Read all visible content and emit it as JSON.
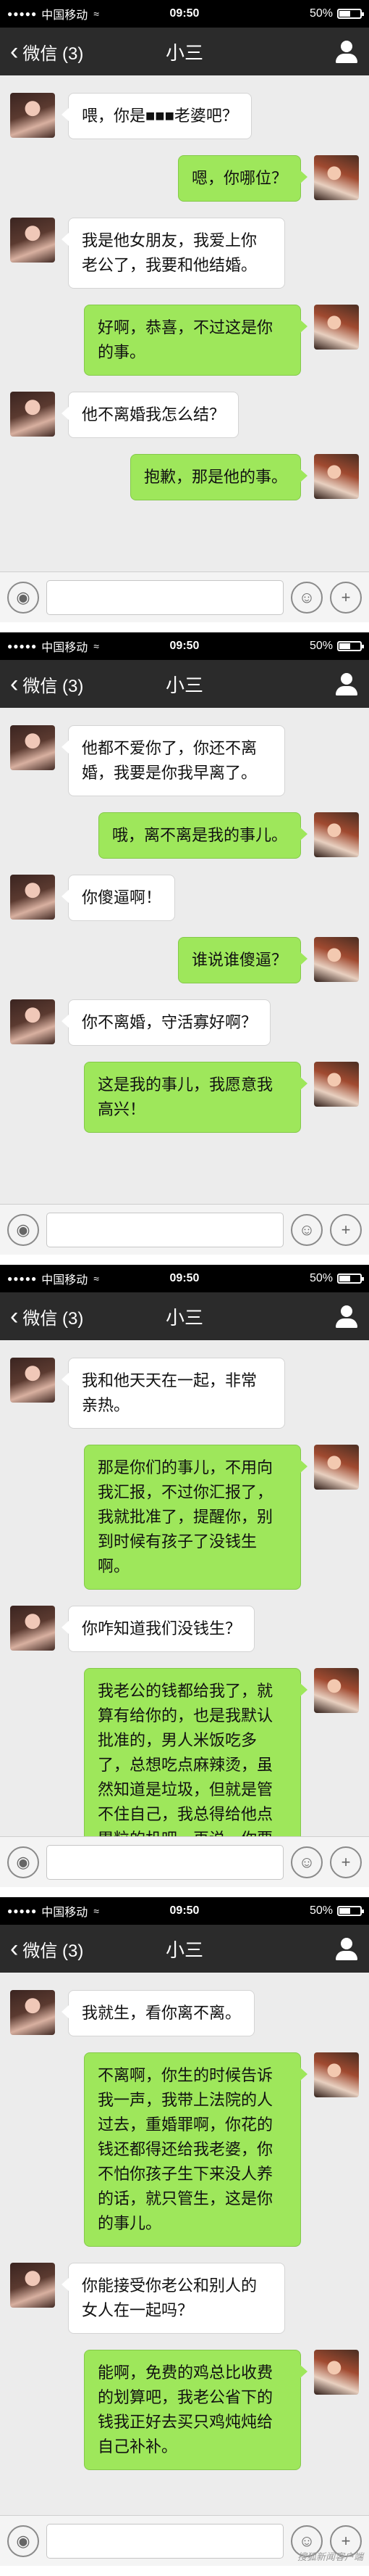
{
  "status_bar": {
    "signal": "●●●●●",
    "carrier": "中国移动",
    "wifi": "≈",
    "time": "09:50",
    "battery_pct": "50%"
  },
  "nav": {
    "back_label": "微信 (3)",
    "title": "小三"
  },
  "panels": [
    {
      "messages": [
        {
          "side": "left",
          "text": "喂，你是■■■老婆吧？"
        },
        {
          "side": "right",
          "text": "嗯，你哪位？"
        },
        {
          "side": "left",
          "text": "我是他女朋友，我爱上你老公了，我要和他结婚。"
        },
        {
          "side": "right",
          "text": "好啊，恭喜，不过这是你的事。"
        },
        {
          "side": "left",
          "text": "他不离婚我怎么结？"
        },
        {
          "side": "right",
          "text": "抱歉，那是他的事。"
        }
      ]
    },
    {
      "messages": [
        {
          "side": "left",
          "text": "他都不爱你了，你还不离婚，我要是你我早离了。"
        },
        {
          "side": "right",
          "text": "哦，离不离是我的事儿。"
        },
        {
          "side": "left",
          "text": "你傻逼啊！"
        },
        {
          "side": "right",
          "text": "谁说谁傻逼？"
        },
        {
          "side": "left",
          "text": "你不离婚，守活寡好啊？"
        },
        {
          "side": "right",
          "text": "这是我的事儿，我愿意我高兴！"
        }
      ]
    },
    {
      "messages": [
        {
          "side": "left",
          "text": "我和他天天在一起，非常亲热。"
        },
        {
          "side": "right",
          "text": "那是你们的事儿，不用向我汇报，不过你汇报了，我就批准了，提醒你，别到时候有孩子了没钱生啊。"
        },
        {
          "side": "left",
          "text": "你咋知道我们没钱生？"
        },
        {
          "side": "right",
          "text": "我老公的钱都给我了，就算有给你的，也是我默认批准的，男人米饭吃多了，总想吃点麻辣烫，虽然知道是垃圾，但就是管不住自己，我总得给他点胃粒的机吧，再说，你要么为他愿意和你生孩子啊！"
        }
      ]
    },
    {
      "messages": [
        {
          "side": "left",
          "text": "我就生，看你离不离。"
        },
        {
          "side": "right",
          "text": "不离啊，你生的时候告诉我一声，我带上法院的人过去，重婚罪啊，你花的钱还都得还给我老婆，你不怕你孩子生下来没人养的话，就只管生，这是你的事儿。"
        },
        {
          "side": "left",
          "text": "你能接受你老公和别人的女人在一起吗？"
        },
        {
          "side": "right",
          "text": "能啊，免费的鸡总比收费的划算吧，我老公省下的钱我正好去买只鸡炖炖给自己补补。"
        }
      ]
    }
  ],
  "input_bar": {
    "voice_icon": "voice-icon",
    "emoji_icon": "emoji-icon",
    "plus_icon": "plus-icon"
  },
  "watermark": "搜狐新闻客户端"
}
